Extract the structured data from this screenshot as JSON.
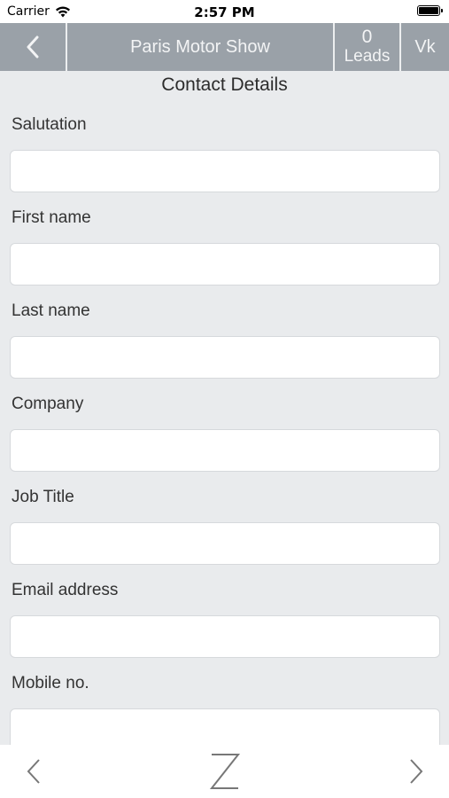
{
  "status_bar": {
    "carrier": "Carrier",
    "time": "2:57 PM"
  },
  "nav": {
    "title": "Paris Motor Show",
    "leads_count": "0",
    "leads_label": "Leads",
    "user_initials": "Vk"
  },
  "section_title": "Contact Details",
  "fields": [
    {
      "label": "Salutation",
      "value": "",
      "placeholder": ""
    },
    {
      "label": "First name",
      "value": "",
      "placeholder": ""
    },
    {
      "label": "Last name",
      "value": "",
      "placeholder": ""
    },
    {
      "label": "Company",
      "value": "",
      "placeholder": ""
    },
    {
      "label": "Job Title",
      "value": "",
      "placeholder": ""
    },
    {
      "label": "Email address",
      "value": "",
      "placeholder": ""
    },
    {
      "label": "Mobile no.",
      "value": "",
      "placeholder": ""
    }
  ],
  "icons": {
    "back": "chevron-left-icon",
    "wifi": "wifi-icon",
    "battery": "battery-icon",
    "prev": "chevron-left-icon",
    "next": "chevron-right-icon",
    "logo": "z-logo"
  },
  "colors": {
    "nav_bg": "#9aa1a8",
    "page_bg": "#e9ebed",
    "nav_text": "#f3f4f5"
  }
}
